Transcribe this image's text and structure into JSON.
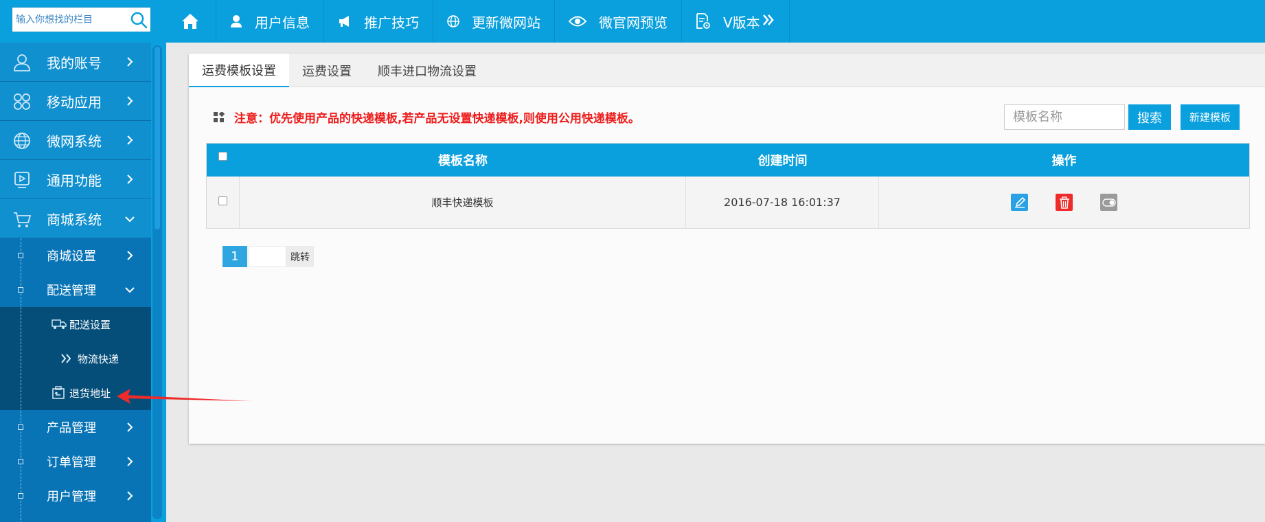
{
  "topbar": {
    "search_placeholder": "输入你想找的栏目",
    "nav": [
      {
        "icon": "home-icon",
        "label": ""
      },
      {
        "icon": "user-icon",
        "label": "用户信息"
      },
      {
        "icon": "megaphone-icon",
        "label": "推广技巧"
      },
      {
        "icon": "globe-icon",
        "label": "更新微网站"
      },
      {
        "icon": "eye-icon",
        "label": "微官网预览"
      },
      {
        "icon": "document-gear-icon",
        "label": "V版本"
      }
    ]
  },
  "sidebar": {
    "main": [
      {
        "icon": "user-icon",
        "label": "我的账号"
      },
      {
        "icon": "apps-icon",
        "label": "移动应用"
      },
      {
        "icon": "globe-icon",
        "label": "微网系统"
      },
      {
        "icon": "play-icon",
        "label": "通用功能"
      },
      {
        "icon": "cart-icon",
        "label": "商城系统"
      }
    ],
    "sub": [
      {
        "label": "商城设置"
      },
      {
        "label": "配送管理"
      },
      {
        "label": "产品管理"
      },
      {
        "label": "订单管理"
      },
      {
        "label": "用户管理"
      }
    ],
    "third": [
      {
        "icon": "truck-icon",
        "label": "配送设置"
      },
      {
        "icon": "double-chevron-icon",
        "label": "物流快递"
      },
      {
        "icon": "return-box-icon",
        "label": "退货地址"
      }
    ]
  },
  "tabs": [
    "运费模板设置",
    "运费设置",
    "顺丰进口物流设置"
  ],
  "notice": "注意：优先使用产品的快递模板,若产品无设置快递模板,则使用公用快递模板。",
  "toolbar": {
    "search_placeholder": "模板名称",
    "search_label": "搜索",
    "new_label": "新建模板"
  },
  "table": {
    "headers": [
      "模板名称",
      "创建时间",
      "操作"
    ],
    "rows": [
      {
        "name": "顺丰快递模板",
        "time": "2016-07-18 16:01:37"
      }
    ]
  },
  "pager": {
    "current": "1",
    "jump_label": "跳转"
  },
  "colors": {
    "primary": "#0aa0de",
    "sidebar": "#0c83c5",
    "sidebar_dark": "#064e7a",
    "notice": "#ee1c1c",
    "delete": "#ee2b2b"
  }
}
